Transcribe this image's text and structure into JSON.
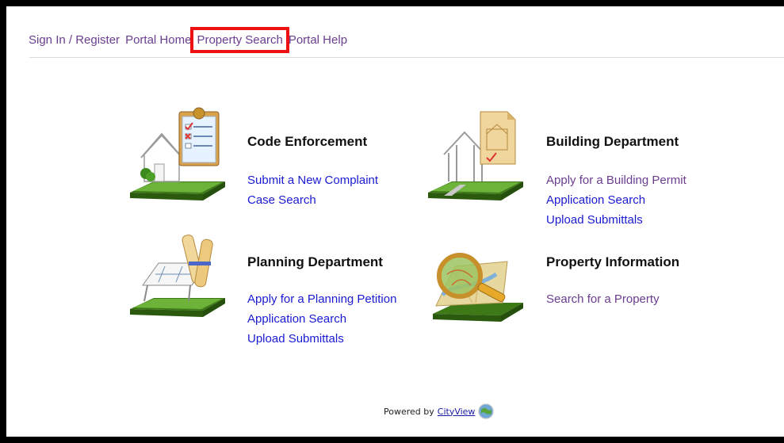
{
  "nav": {
    "items": [
      {
        "label": "Sign In / Register"
      },
      {
        "label": "Portal Home"
      },
      {
        "label": "Property Search"
      },
      {
        "label": "Portal Help"
      }
    ]
  },
  "cards": [
    {
      "title": "Code Enforcement",
      "links": [
        "Submit a New Complaint",
        "Case Search"
      ],
      "icon": "house-clipboard-icon"
    },
    {
      "title": "Building Department",
      "links": [
        "Apply for a Building Permit",
        "Application Search",
        "Upload Submittals"
      ],
      "icon": "house-blueprint-icon"
    },
    {
      "title": "Planning Department",
      "links": [
        "Apply for a Planning Petition",
        "Application Search",
        "Upload Submittals"
      ],
      "icon": "blueprint-scroll-icon"
    },
    {
      "title": "Property Information",
      "links": [
        "Search for a Property"
      ],
      "icon": "map-magnifier-icon"
    }
  ],
  "footer": {
    "powered_by": "Powered by",
    "brand": "CityView"
  },
  "colors": {
    "nav": "#6a3d8f",
    "link_blue": "#1a1ad2",
    "link_purple": "#6a3d8f",
    "highlight": "#e11111"
  }
}
